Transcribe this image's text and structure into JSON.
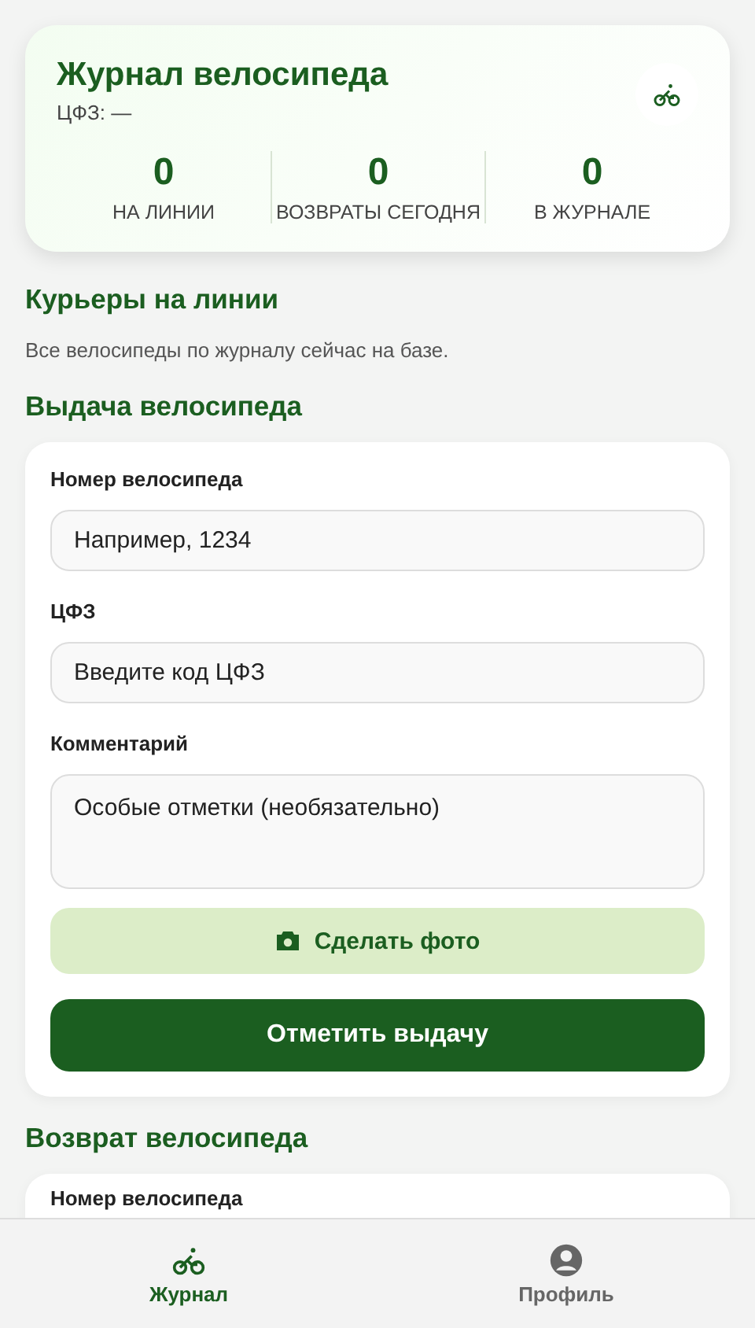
{
  "header": {
    "title": "Журнал велосипеда",
    "subtitle": "ЦФЗ: —",
    "stats": [
      {
        "value": "0",
        "label": "НА ЛИНИИ"
      },
      {
        "value": "0",
        "label": "ВОЗВРАТЫ СЕГОДНЯ"
      },
      {
        "value": "0",
        "label": "В ЖУРНАЛЕ"
      }
    ]
  },
  "couriers": {
    "title": "Курьеры на линии",
    "text": "Все велосипеды по журналу сейчас на базе."
  },
  "issue": {
    "title": "Выдача велосипеда",
    "fields": [
      {
        "kind": "input",
        "label": "Номер велосипеда",
        "placeholder": "Например, 1234"
      },
      {
        "kind": "input",
        "label": "ЦФЗ",
        "placeholder": "Введите код ЦФЗ"
      },
      {
        "kind": "textarea",
        "label": "Комментарий",
        "placeholder": "Особые отметки (необязательно)"
      }
    ],
    "photo_button": "Сделать фото",
    "submit_button": "Отметить выдачу"
  },
  "return": {
    "title": "Возврат велосипеда",
    "first_label": "Номер велосипеда"
  },
  "nav": [
    {
      "kind": "bike",
      "label": "Журнал",
      "selected": true
    },
    {
      "kind": "profile",
      "label": "Профиль",
      "selected": false
    }
  ]
}
